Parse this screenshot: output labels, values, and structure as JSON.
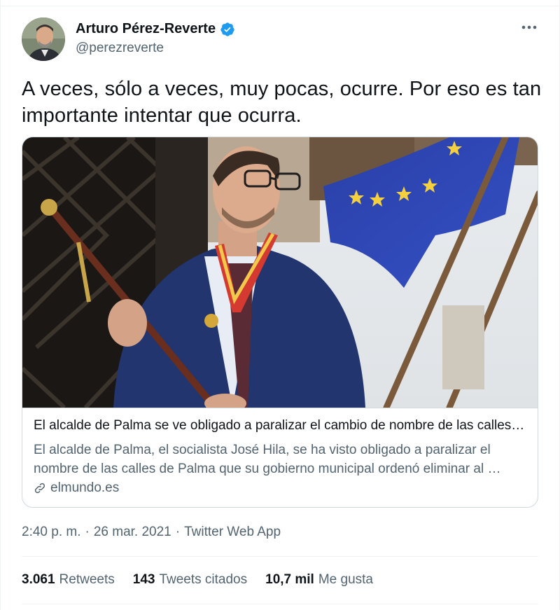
{
  "author": {
    "display_name": "Arturo Pérez-Reverte",
    "handle": "@perezreverte",
    "verified_icon": "verified-badge-icon"
  },
  "more_icon": "more-horizontal-icon",
  "tweet": {
    "text": "A veces, sólo a veces, muy pocas, ocurre. Por eso es tan importante intentar que ocurra."
  },
  "card": {
    "title": "El alcalde de Palma se ve obligado a paralizar el cambio de nombre de las calles…",
    "description": "El alcalde de Palma, el socialista José Hila, se ha visto obligado a paralizar el nombre de las calles de Palma que su gobierno municipal ordenó eliminar al …",
    "domain": "elmundo.es",
    "link_icon": "link-icon"
  },
  "meta": {
    "time": "2:40 p. m.",
    "sep1": "·",
    "date": "26 mar. 2021",
    "sep2": "·",
    "app": "Twitter Web App"
  },
  "stats": {
    "retweets_count": "3.061",
    "retweets_label": "Retweets",
    "quotes_count": "143",
    "quotes_label": "Tweets citados",
    "likes_count": "10,7 mil",
    "likes_label": "Me gusta"
  },
  "colors": {
    "text_primary": "#0f1419",
    "text_secondary": "#536471",
    "verified_blue": "#1d9bf0",
    "border": "#cfd9de"
  }
}
